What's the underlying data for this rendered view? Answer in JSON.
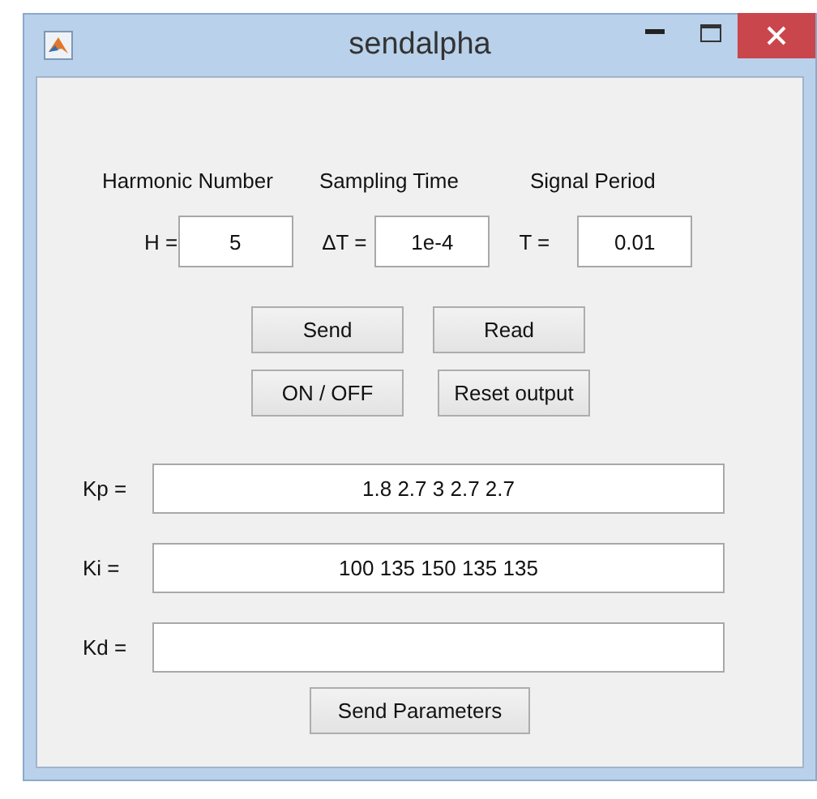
{
  "window": {
    "title": "sendalpha"
  },
  "parameters": [
    {
      "heading": "Harmonic Number",
      "prefix": "H =",
      "value": "5"
    },
    {
      "heading": "Sampling Time",
      "prefix": "ΔT =",
      "value": "1e-4"
    },
    {
      "heading": "Signal Period",
      "prefix": "T =",
      "value": "0.01"
    }
  ],
  "button_rows": [
    [
      "Send",
      "Read"
    ],
    [
      "ON / OFF",
      "Reset output"
    ]
  ],
  "gains": [
    {
      "label": "Kp =",
      "value": "1.8 2.7 3 2.7 2.7"
    },
    {
      "label": "Ki =",
      "value": "100 135 150 135 135"
    },
    {
      "label": "Kd ="
    }
  ],
  "send_parameters": "Send Parameters"
}
